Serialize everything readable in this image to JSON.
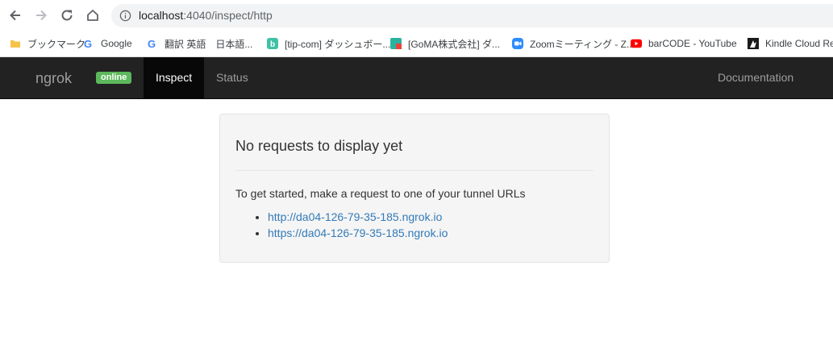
{
  "browser": {
    "url_host": "localhost",
    "url_path": ":4040/inspect/http",
    "bookmarks": [
      {
        "label": "ブックマーク",
        "icon": "folder-icon"
      },
      {
        "label": "Google",
        "icon": "google-icon"
      },
      {
        "label": "翻訳 英語　日本語...",
        "icon": "google-icon"
      },
      {
        "label": "[tip-com] ダッシュボー...",
        "icon": "b-icon"
      },
      {
        "label": "[GoMA株式会社] ダ...",
        "icon": "goma-icon"
      },
      {
        "label": "Zoomミーティング - Z...",
        "icon": "zoom-icon"
      },
      {
        "label": "barCODE - YouTube",
        "icon": "youtube-icon"
      },
      {
        "label": "Kindle Cloud Re",
        "icon": "kindle-icon"
      }
    ]
  },
  "navbar": {
    "brand": "ngrok",
    "status_badge": "online",
    "items": [
      {
        "label": "Inspect",
        "active": true
      },
      {
        "label": "Status",
        "active": false
      }
    ],
    "right_item": "Documentation"
  },
  "main": {
    "heading": "No requests to display yet",
    "intro": "To get started, make a request to one of your tunnel URLs",
    "tunnel_urls": [
      "http://da04-126-79-35-185.ngrok.io",
      "https://da04-126-79-35-185.ngrok.io"
    ]
  },
  "colors": {
    "navbar_bg": "#222222",
    "badge_green": "#5cb85c",
    "link_blue": "#337ab7"
  }
}
